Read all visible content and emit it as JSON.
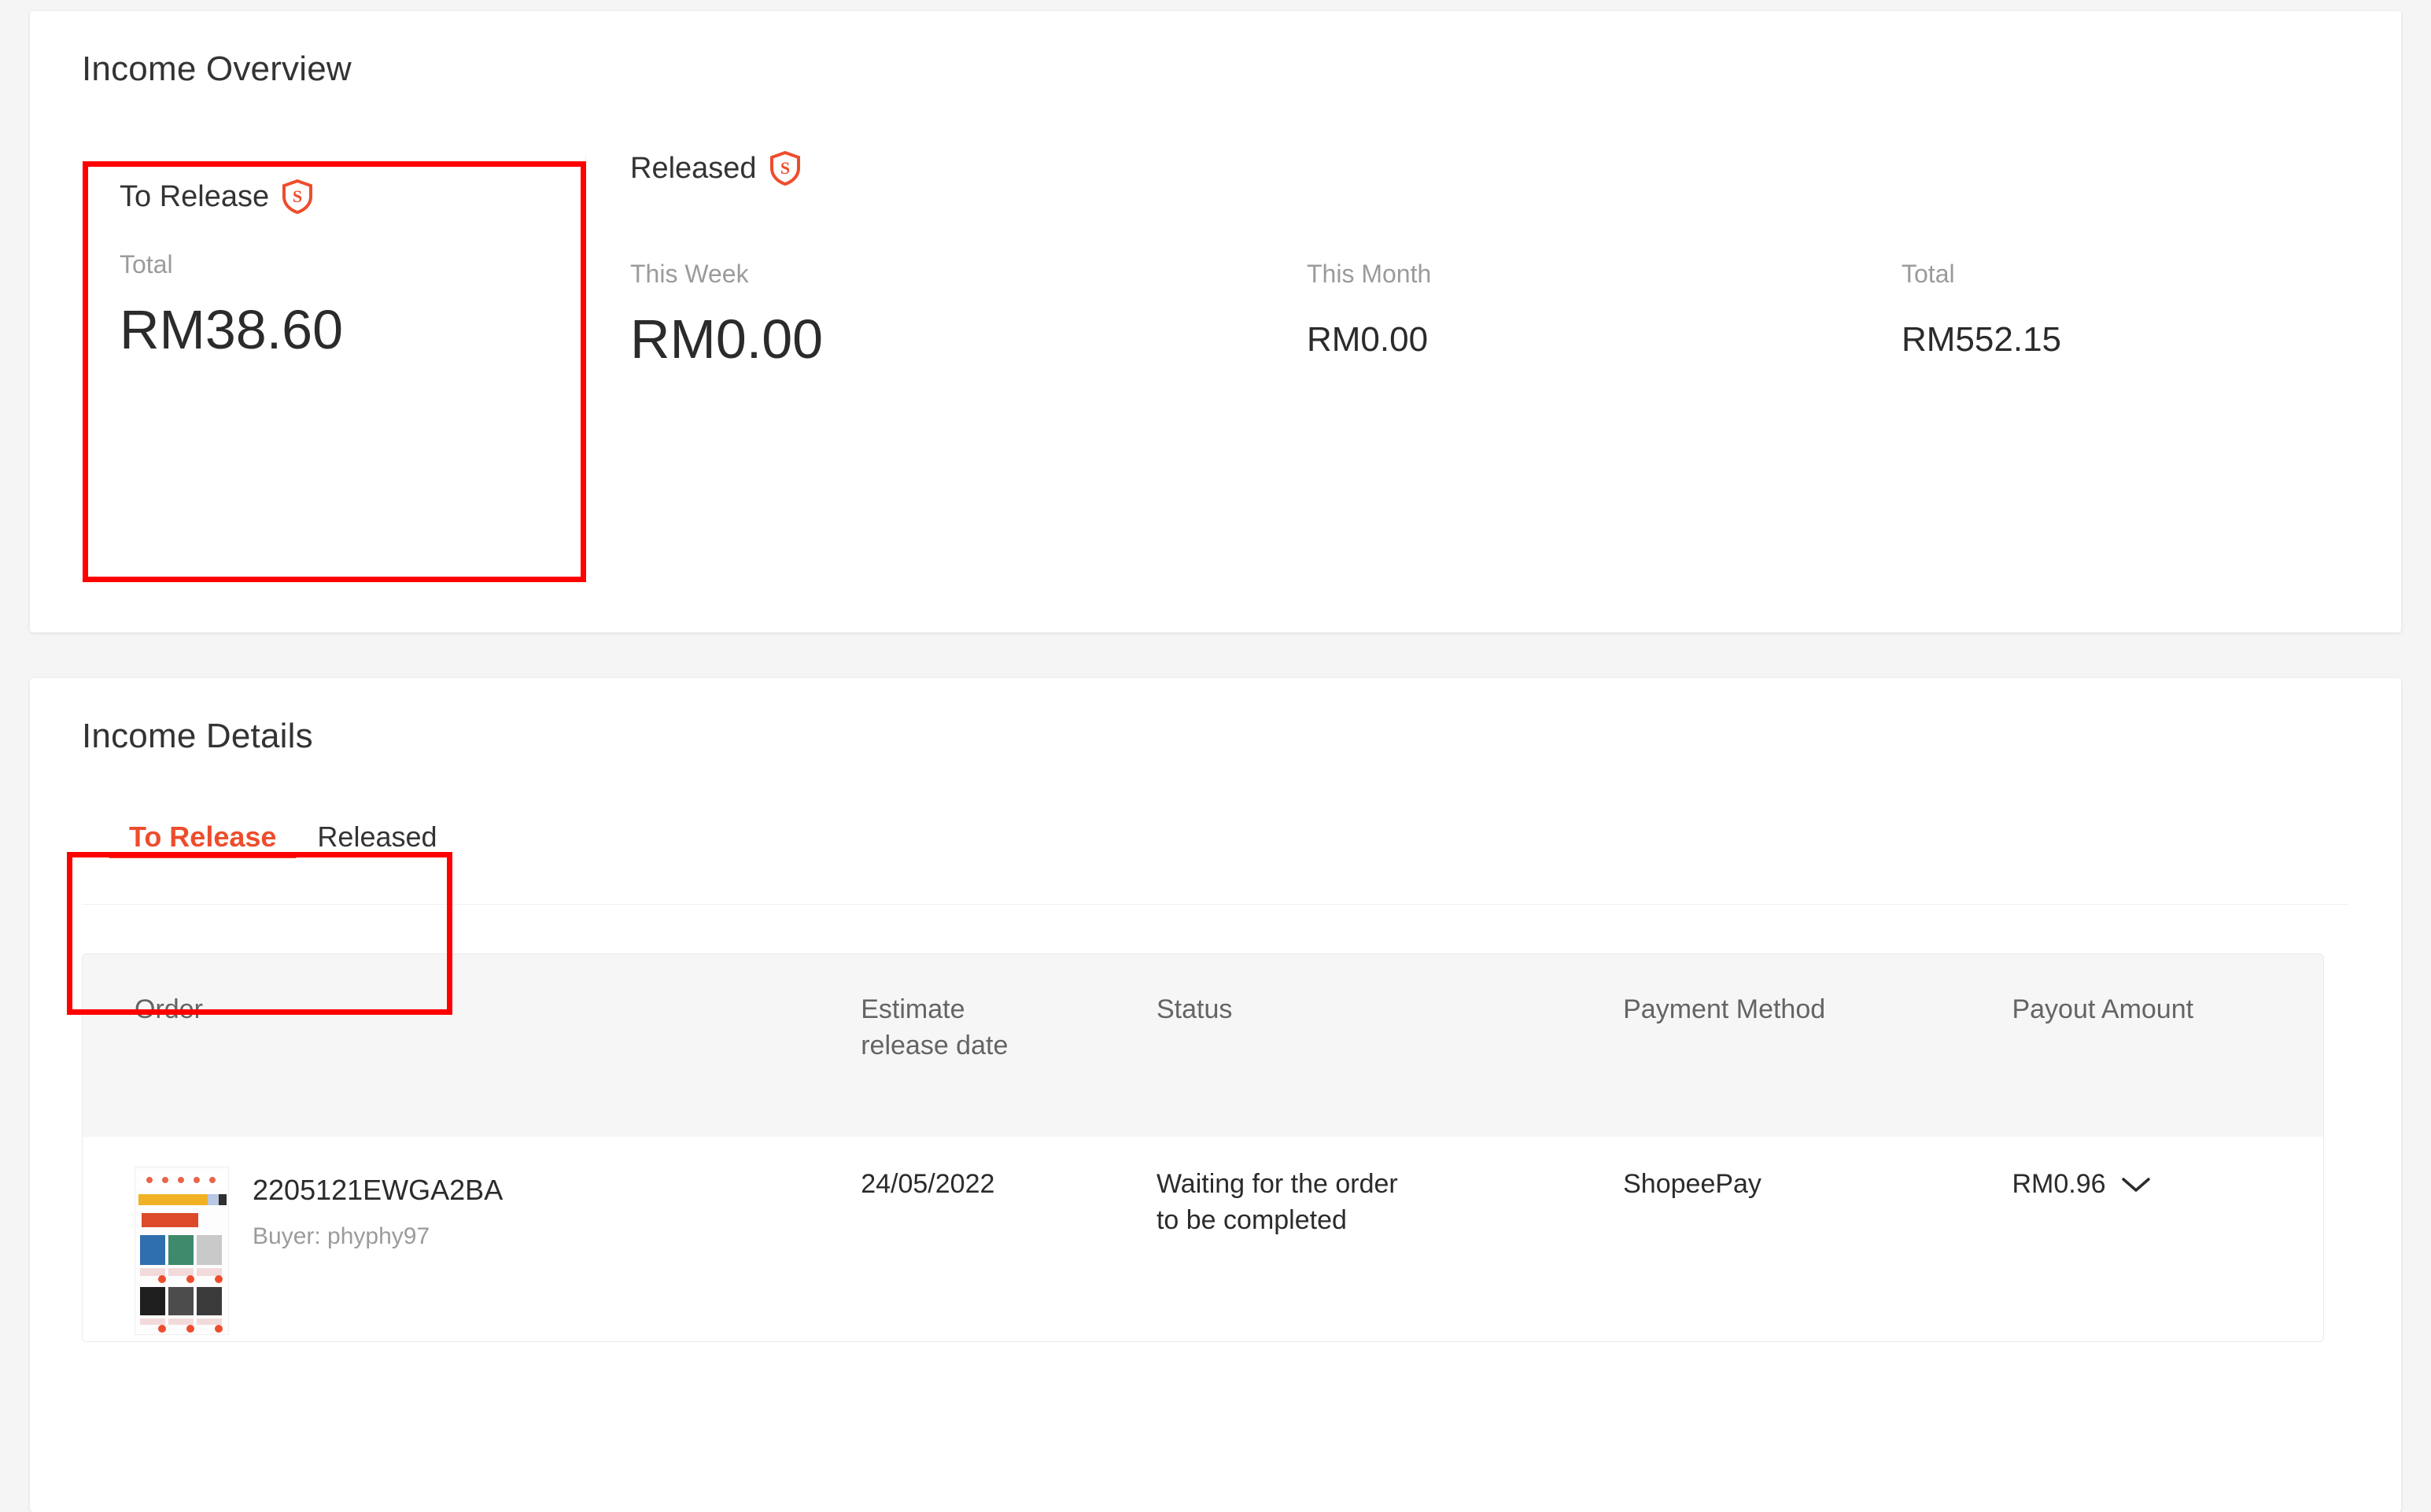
{
  "overview": {
    "title": "Income Overview",
    "to_release": {
      "heading": "To Release",
      "badge_icon": "shopee-guarantee-shield-icon",
      "label": "Total",
      "value": "RM38.60"
    },
    "released": {
      "heading": "Released",
      "badge_icon": "shopee-guarantee-shield-icon",
      "columns": [
        {
          "label": "This Week",
          "value": "RM0.00"
        },
        {
          "label": "This Month",
          "value": "RM0.00"
        },
        {
          "label": "Total",
          "value": "RM552.15"
        }
      ]
    }
  },
  "details": {
    "title": "Income Details",
    "tabs": [
      {
        "label": "To Release",
        "active": true
      },
      {
        "label": "Released",
        "active": false
      }
    ],
    "table": {
      "headers": {
        "order": "Order",
        "date": "Estimate release date",
        "date_line1": "Estimate",
        "date_line2": "release date",
        "status": "Status",
        "payment": "Payment Method",
        "payout": "Payout Amount"
      },
      "rows": [
        {
          "thumbnail": "product-thumbnail",
          "order_id": "2205121EWGA2BA",
          "buyer": "Buyer: phyphy97",
          "date": "24/05/2022",
          "status": "Waiting for the order to be completed",
          "status_line1": "Waiting for the order",
          "status_line2": "to be completed",
          "payment_method": "ShopeePay",
          "payout_amount": "RM0.96",
          "expand_icon": "chevron-down-icon"
        }
      ]
    }
  },
  "annotations": [
    {
      "name": "to-release-total-highlight",
      "color": "#fe0000"
    },
    {
      "name": "to-release-tab-highlight",
      "color": "#fe0000"
    }
  ],
  "colors": {
    "accent": "#ee4d2d",
    "annotation": "#fe0000",
    "page_bg": "#f5f5f5",
    "card_bg": "#ffffff",
    "muted_text": "#9b9b9b",
    "primary_text": "#2b2b2b"
  }
}
